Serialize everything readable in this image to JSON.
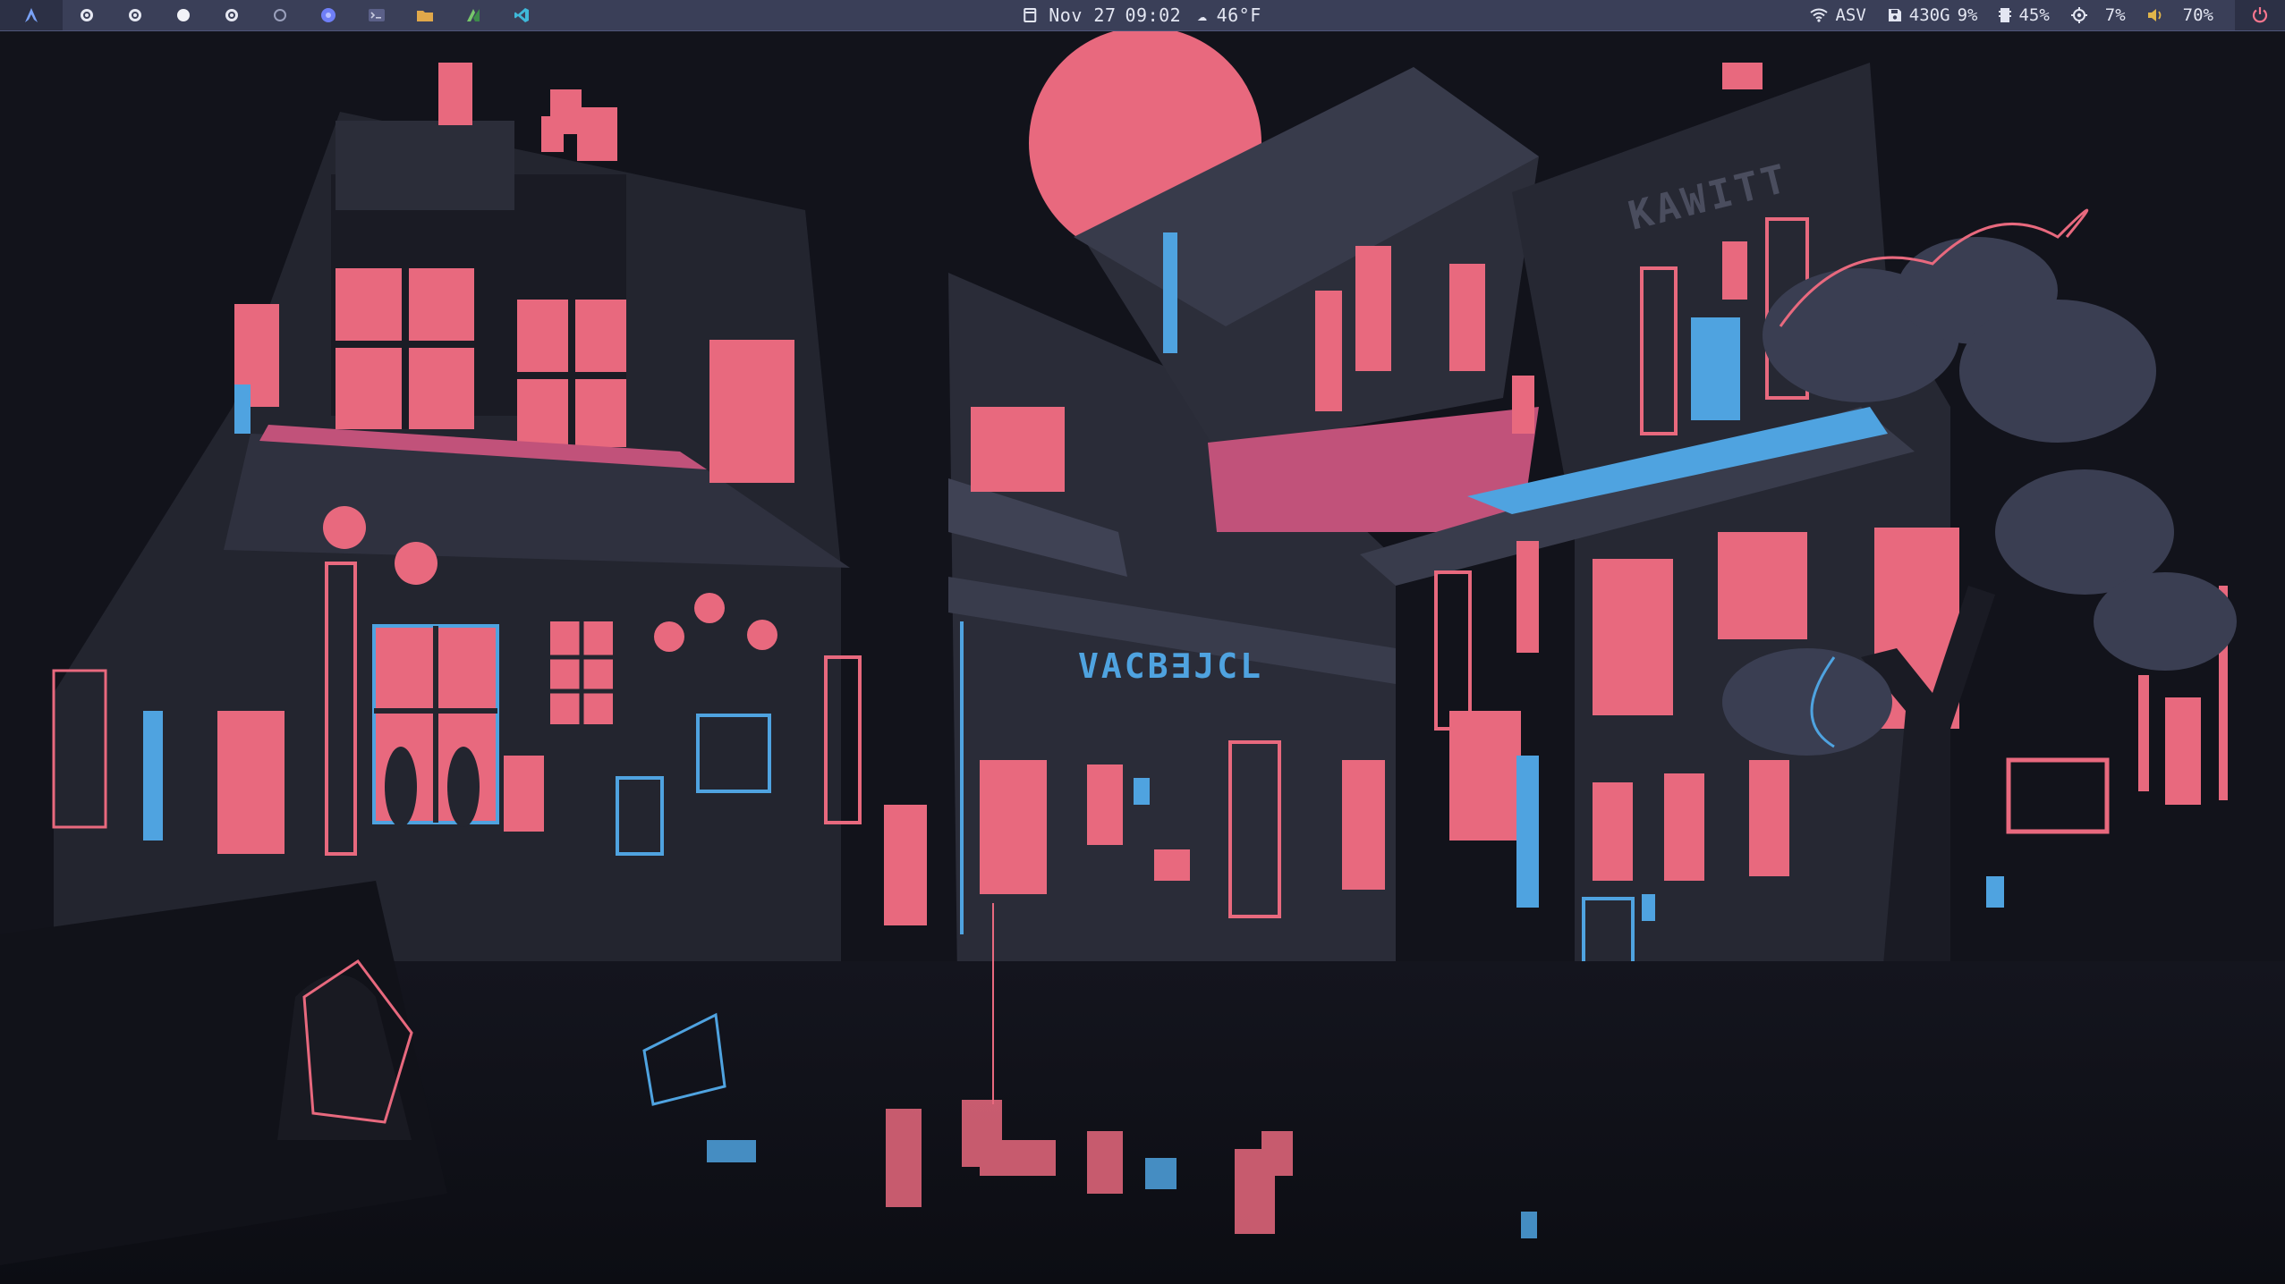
{
  "panel": {
    "launcher_icon": "arch-icon",
    "workspaces": [
      {
        "state": "occupied"
      },
      {
        "state": "occupied"
      },
      {
        "state": "active"
      },
      {
        "state": "occupied"
      },
      {
        "state": "empty"
      }
    ],
    "apps": [
      {
        "icon": "browser-icon",
        "color": "#6f7ff7"
      },
      {
        "icon": "terminal-icon",
        "color": "#7a7fa8"
      },
      {
        "icon": "folder-icon",
        "color": "#e0a84a"
      },
      {
        "icon": "android-studio-icon",
        "color": "#77c76c"
      },
      {
        "icon": "vscode-icon",
        "color": "#3fb8d9"
      }
    ],
    "clock": {
      "date": "Nov 27",
      "time": "09:02",
      "temperature": "46°F"
    },
    "network": "ASV",
    "disk": "430G",
    "disk_percent": "9%",
    "memory": "45%",
    "cpu": "7%",
    "volume": "70%"
  },
  "colors": {
    "panel_bg": "#3a3f58",
    "accent_pink": "#e8697e",
    "accent_blue": "#4fa3e0",
    "night_bg": "#12131b"
  },
  "wallpaper": {
    "signs": {
      "shop_sign": "VACB∃JCL",
      "top_sign": "KAWITT"
    }
  }
}
